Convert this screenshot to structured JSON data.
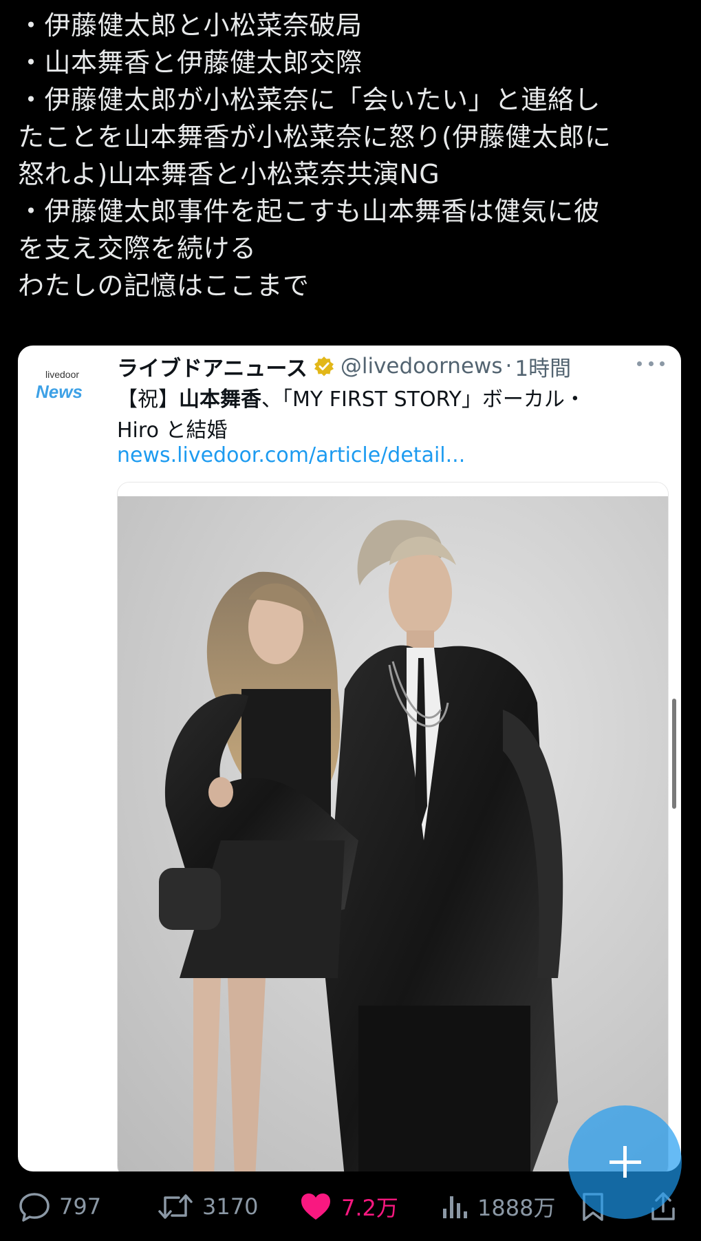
{
  "tweet": {
    "lines": [
      "・伊藤健太郎と小松菜奈破局",
      "・山本舞香と伊藤健太郎交際",
      "・伊藤健太郎が小松菜奈に「会いたい」と連絡し",
      "たことを山本舞香が小松菜奈に怒り(伊藤健太郎に",
      "怒れよ)山本舞香と小松菜奈共演NG",
      "・伊藤健太郎事件を起こすも山本舞香は健気に彼",
      "を支え交際を続ける",
      "わたしの記憶はここまで"
    ]
  },
  "quote": {
    "avatar_small": "livedoor",
    "avatar_big": "News",
    "author_name": "ライブドアニュース",
    "handle": "@livedoornews",
    "separator": "·",
    "time": "1時間",
    "body_prefix": "【祝】",
    "body_bold": "山本舞香",
    "body_rest": "、「MY FIRST STORY」ボーカル・",
    "body_line2": "Hiro と結婚",
    "link": "news.livedoor.com/article/detail..."
  },
  "actions": {
    "replies": "797",
    "retweets": "3170",
    "likes": "7.2万",
    "views": "1888万"
  },
  "colors": {
    "background": "#000000",
    "text": "#e7e9ea",
    "muted": "#8b98a5",
    "link": "#1d9bf0",
    "like": "#f91880",
    "verified": "#e2b719"
  },
  "icons": [
    "reply-icon",
    "retweet-icon",
    "heart-icon",
    "views-icon",
    "bookmark-icon",
    "share-icon",
    "plus-icon",
    "verified-badge-icon",
    "more-icon"
  ]
}
